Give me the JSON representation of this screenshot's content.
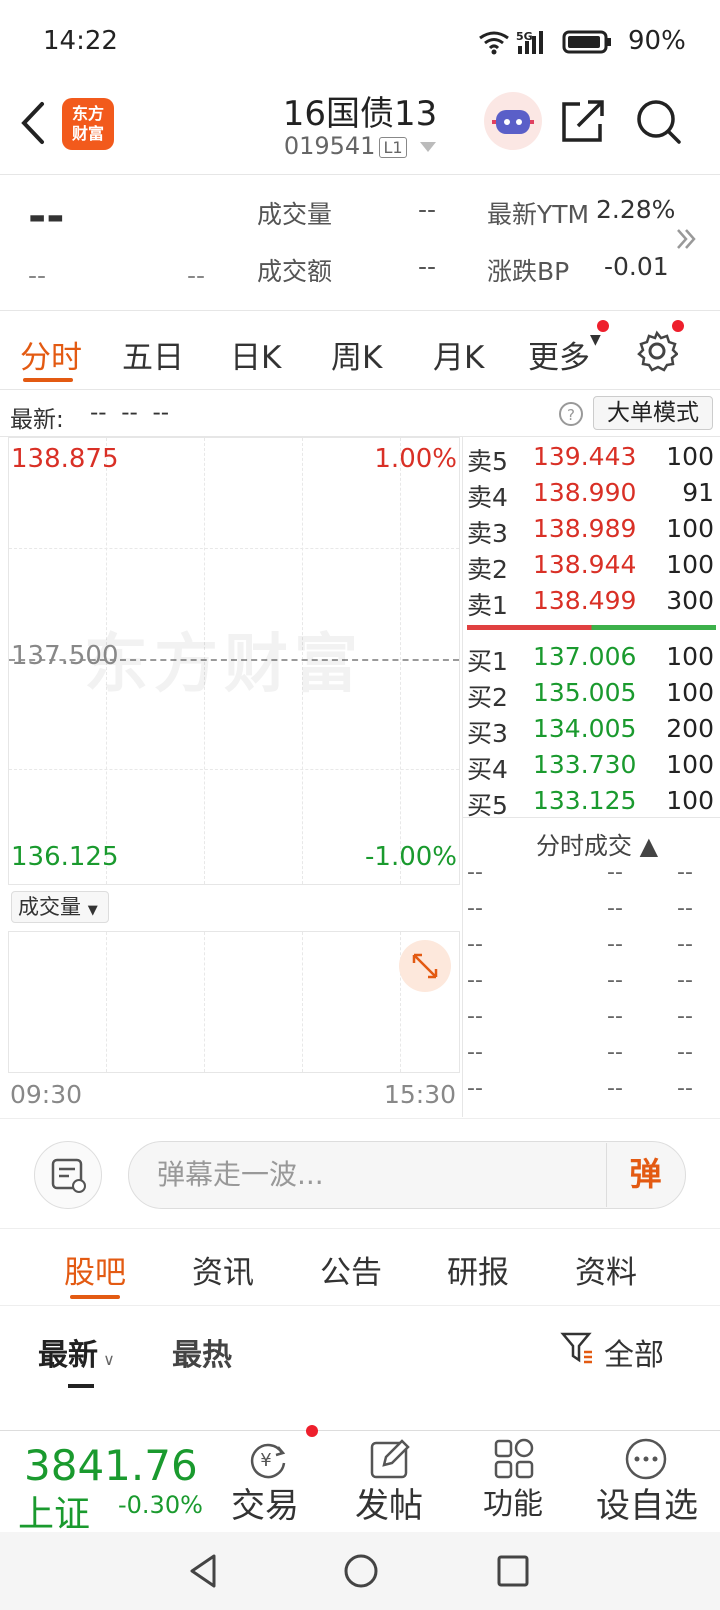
{
  "status": {
    "time": "14:22",
    "battery": "90%"
  },
  "header": {
    "logo": "东方\n财富",
    "title": "16国债13",
    "code": "019541",
    "level": "L1"
  },
  "quote": {
    "last": "--",
    "sub_left": "--",
    "sub_right": "--",
    "volume_label": "成交量",
    "volume": "--",
    "turnover_label": "成交额",
    "turnover": "--",
    "ytm_label": "最新YTM",
    "ytm": "2.28%",
    "bp_label": "涨跌BP",
    "bp": "-0.01"
  },
  "tabs": [
    "分时",
    "五日",
    "日K",
    "周K",
    "月K",
    "更多"
  ],
  "latest": {
    "label": "最新:",
    "values": "--  --  --",
    "big_order": "大单模式"
  },
  "chart": {
    "top_price": "138.875",
    "top_pct": "1.00%",
    "mid_price": "137.500",
    "bottom_price": "136.125",
    "bottom_pct": "-1.00%",
    "watermark": "东方财富",
    "volume_label": "成交量",
    "time_start": "09:30",
    "time_end": "15:30"
  },
  "orderbook": {
    "asks": [
      {
        "label": "卖5",
        "price": "139.443",
        "qty": "100"
      },
      {
        "label": "卖4",
        "price": "138.990",
        "qty": "91"
      },
      {
        "label": "卖3",
        "price": "138.989",
        "qty": "100"
      },
      {
        "label": "卖2",
        "price": "138.944",
        "qty": "100"
      },
      {
        "label": "卖1",
        "price": "138.499",
        "qty": "300"
      }
    ],
    "bids": [
      {
        "label": "买1",
        "price": "137.006",
        "qty": "100"
      },
      {
        "label": "买2",
        "price": "135.005",
        "qty": "100"
      },
      {
        "label": "买3",
        "price": "134.005",
        "qty": "200"
      },
      {
        "label": "买4",
        "price": "133.730",
        "qty": "100"
      },
      {
        "label": "买5",
        "price": "133.125",
        "qty": "100"
      }
    ],
    "ticks_title": "分时成交 ▲",
    "tick_placeholder": "--"
  },
  "comment": {
    "placeholder": "弹幕走一波...",
    "send": "弹"
  },
  "sections": [
    "股吧",
    "资讯",
    "公告",
    "研报",
    "资料"
  ],
  "filter": {
    "latest": "最新",
    "hot": "最热",
    "all": "全部"
  },
  "bottom_nav": {
    "index_value": "3841.76",
    "index_name": "上证",
    "index_change": "-0.30%",
    "trade": "交易",
    "post": "发帖",
    "functions": "功能",
    "watchlist": "设自选"
  },
  "colors": {
    "accent": "#e35a12",
    "up": "#d93026",
    "down": "#1a9a2e"
  }
}
